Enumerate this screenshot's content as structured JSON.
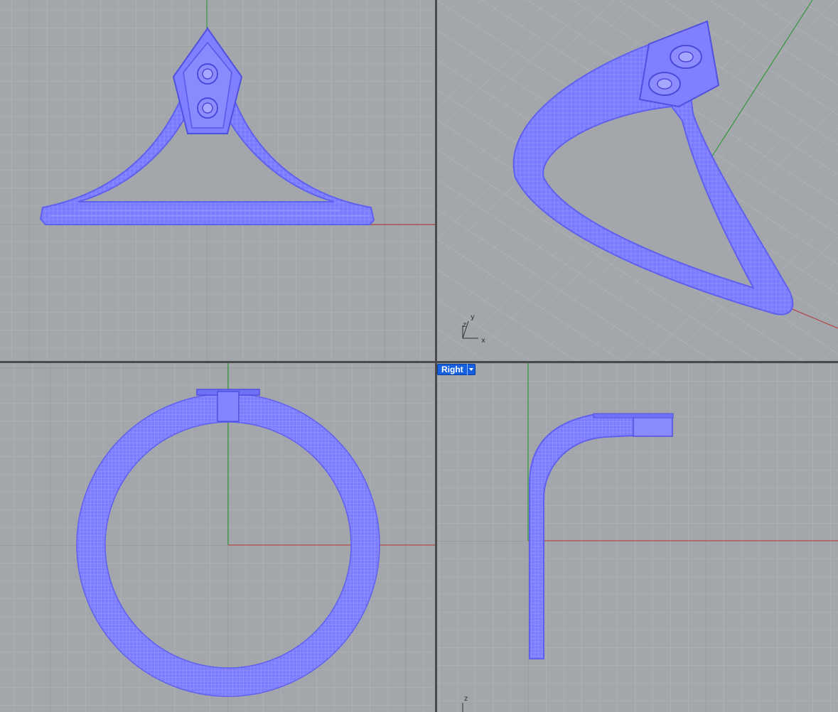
{
  "viewports": {
    "top": {
      "label": ""
    },
    "perspective": {
      "label": "",
      "axis_labels": {
        "y": "y",
        "z": "z",
        "x": "x"
      }
    },
    "front": {
      "label": ""
    },
    "right": {
      "label": "Right",
      "active": true,
      "axis_labels": {
        "z": "z"
      }
    }
  },
  "icons": {
    "viewport_menu": "chevron-down-icon",
    "axis_widget": "axis-icon"
  },
  "colors": {
    "viewport_background": "#a3a6aa",
    "grid_minor": "#b3b6ba",
    "grid_major": "#8e9194",
    "x_axis": "#b43232",
    "y_axis": "#1e9628",
    "object_wire": "#7878ff",
    "active_label": "#1560e0"
  }
}
